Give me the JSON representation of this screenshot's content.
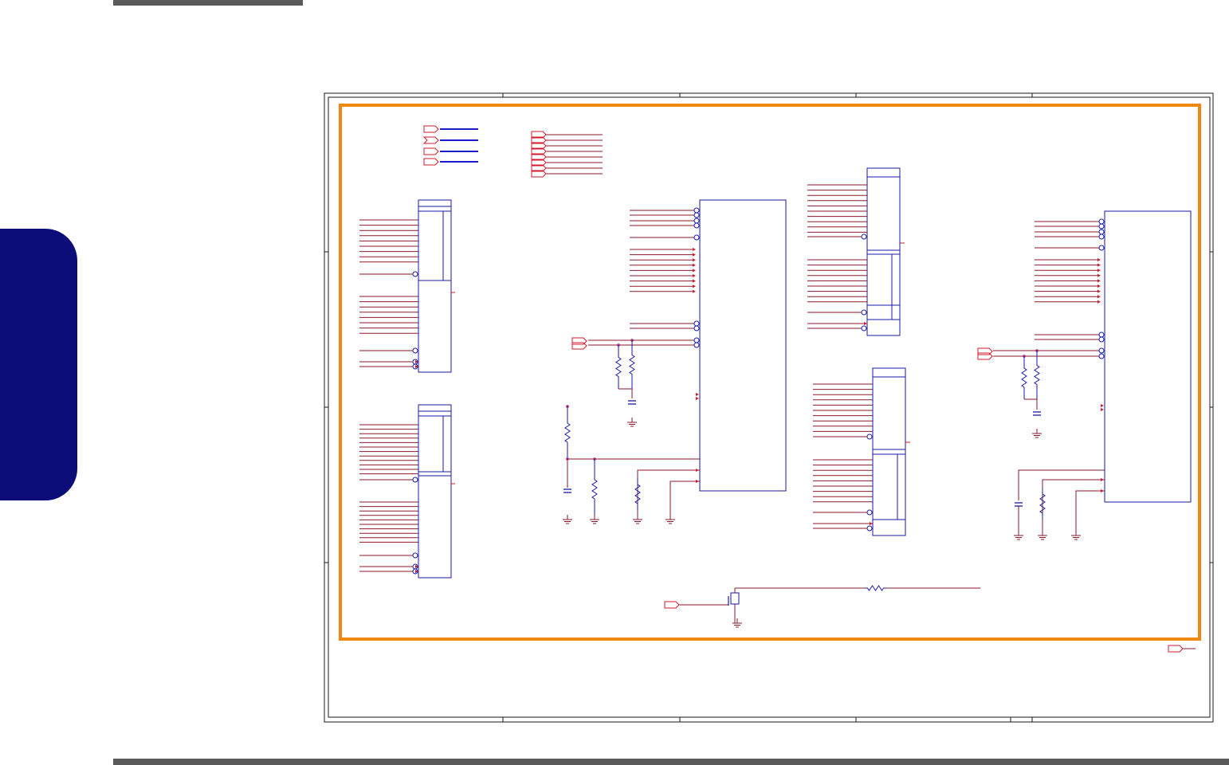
{
  "page": {
    "header_rule_color": "#5a5a5a",
    "footer_rule_color": "#5a5a5a",
    "side_tab_color": "#0d0d7a"
  },
  "schematic": {
    "frame_color": "#1a1a1a",
    "highlight_color": "#f0880f",
    "wire_color": "#8b1a2b",
    "part_color": "#1a1aa6",
    "bus_color": "#1a1ad0",
    "port_color": "#d01a2b",
    "texts_visible": false
  }
}
